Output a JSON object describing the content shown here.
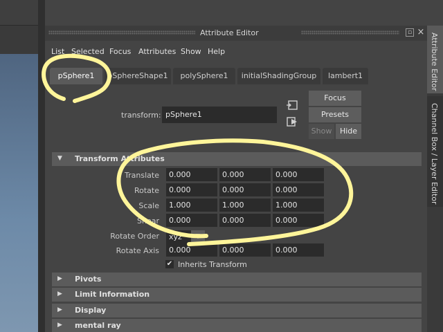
{
  "panel": {
    "title": "Attribute Editor",
    "float_icon": "float-window-icon",
    "close_icon": "close-icon",
    "close_glyph": "×"
  },
  "menu": [
    "List",
    "Selected",
    "Focus",
    "Attributes",
    "Show",
    "Help"
  ],
  "tabs": [
    "pSphere1",
    "pSphereShape1",
    "polySphere1",
    "initialShadingGroup",
    "lambert1"
  ],
  "transform": {
    "label": "transform:",
    "value": "pSphere1"
  },
  "buttons": {
    "focus": "Focus",
    "presets": "Presets",
    "show": "Show",
    "hide": "Hide"
  },
  "sections": {
    "transform_attributes": "Transform Attributes",
    "pivots": "Pivots",
    "limit_information": "Limit Information",
    "display": "Display",
    "mental_ray": "mental ray"
  },
  "attributes": {
    "translate": {
      "label": "Translate",
      "values": [
        "0.000",
        "0.000",
        "0.000"
      ]
    },
    "rotate": {
      "label": "Rotate",
      "values": [
        "0.000",
        "0.000",
        "0.000"
      ]
    },
    "scale": {
      "label": "Scale",
      "values": [
        "1.000",
        "1.000",
        "1.000"
      ]
    },
    "shear": {
      "label": "Shear",
      "values": [
        "0.000",
        "0.000",
        "0.000"
      ]
    },
    "rotate_order": {
      "label": "Rotate Order",
      "value": "xyz"
    },
    "rotate_axis": {
      "label": "Rotate Axis",
      "values": [
        "0.000",
        "0.000",
        "0.000"
      ]
    },
    "inherits_transform": {
      "label": "Inherits Transform",
      "checked": true,
      "glyph": "✔"
    }
  },
  "dock": {
    "attribute_editor": "Attribute Editor",
    "channel_box": "Channel Box / Layer Editor"
  },
  "colors": {
    "annotation": "#fff59a",
    "panel_bg": "#444444"
  }
}
